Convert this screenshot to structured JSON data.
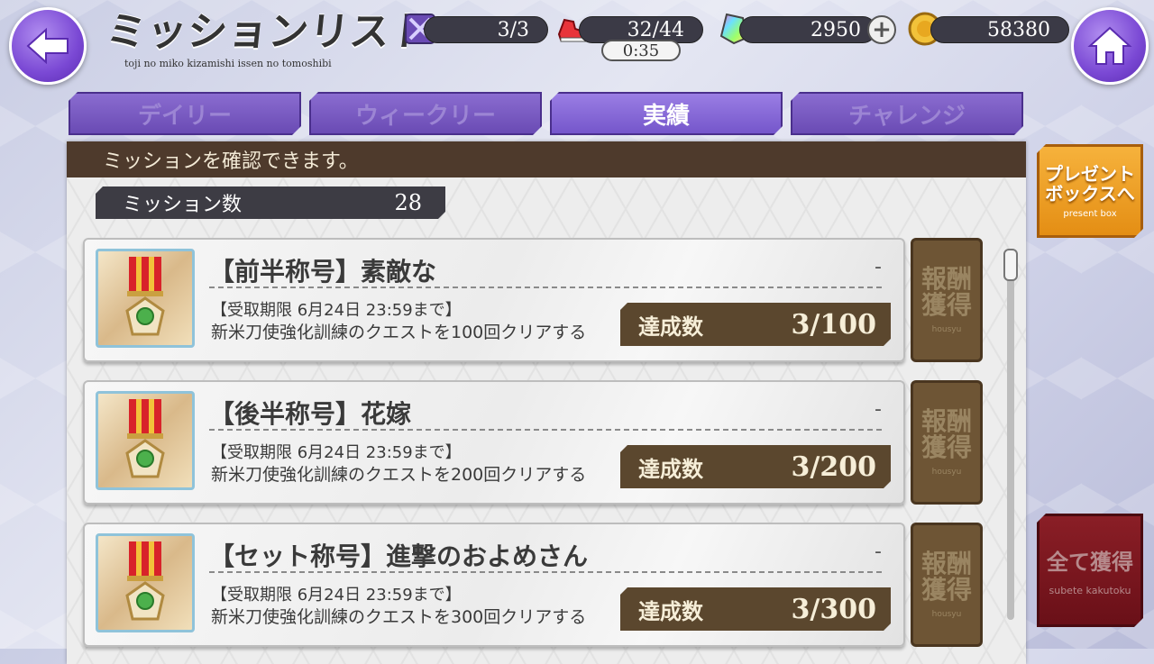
{
  "header": {
    "title": "ミッションリスト",
    "subtitle": "toji no miko kizamishi issen no tomoshibi"
  },
  "resources": {
    "battle": "3/3",
    "stamina": "32/44",
    "stamina_timer": "0:35",
    "crystals": "2950",
    "coins": "58380"
  },
  "tabs": [
    {
      "label": "デイリー",
      "active": false
    },
    {
      "label": "ウィークリー",
      "active": false
    },
    {
      "label": "実績",
      "active": true
    },
    {
      "label": "チャレンジ",
      "active": false
    }
  ],
  "panel": {
    "header": "ミッションを確認できます。",
    "count_label": "ミッション数",
    "count_value": "28"
  },
  "missions": [
    {
      "title": "【前半称号】素敵な",
      "dash": "-",
      "deadline": "【受取期限 6月24日 23:59まで】",
      "desc": "新米刀使強化訓練のクエストを100回クリアする",
      "progress_label": "達成数",
      "progress": "3/100"
    },
    {
      "title": "【後半称号】花嫁",
      "dash": "-",
      "deadline": "【受取期限 6月24日 23:59まで】",
      "desc": "新米刀使強化訓練のクエストを200回クリアする",
      "progress_label": "達成数",
      "progress": "3/200"
    },
    {
      "title": "【セット称号】進撃のおよめさん",
      "dash": "-",
      "deadline": "【受取期限 6月24日 23:59まで】",
      "desc": "新米刀使強化訓練のクエストを300回クリアする",
      "progress_label": "達成数",
      "progress": "3/300"
    }
  ],
  "reward_button": {
    "label": "報酬獲得",
    "sub": "housyu"
  },
  "present_box": {
    "label": "プレゼントボックスへ",
    "sub": "present box"
  },
  "claim_all": {
    "label": "全て獲得",
    "sub": "subete kakutoku"
  },
  "colors": {
    "accent_purple": "#7a48d4",
    "panel_brown": "#4e3a2c",
    "progress_brown": "#5b472e",
    "present_orange": "#e48e14",
    "claim_red": "#7a1820"
  }
}
